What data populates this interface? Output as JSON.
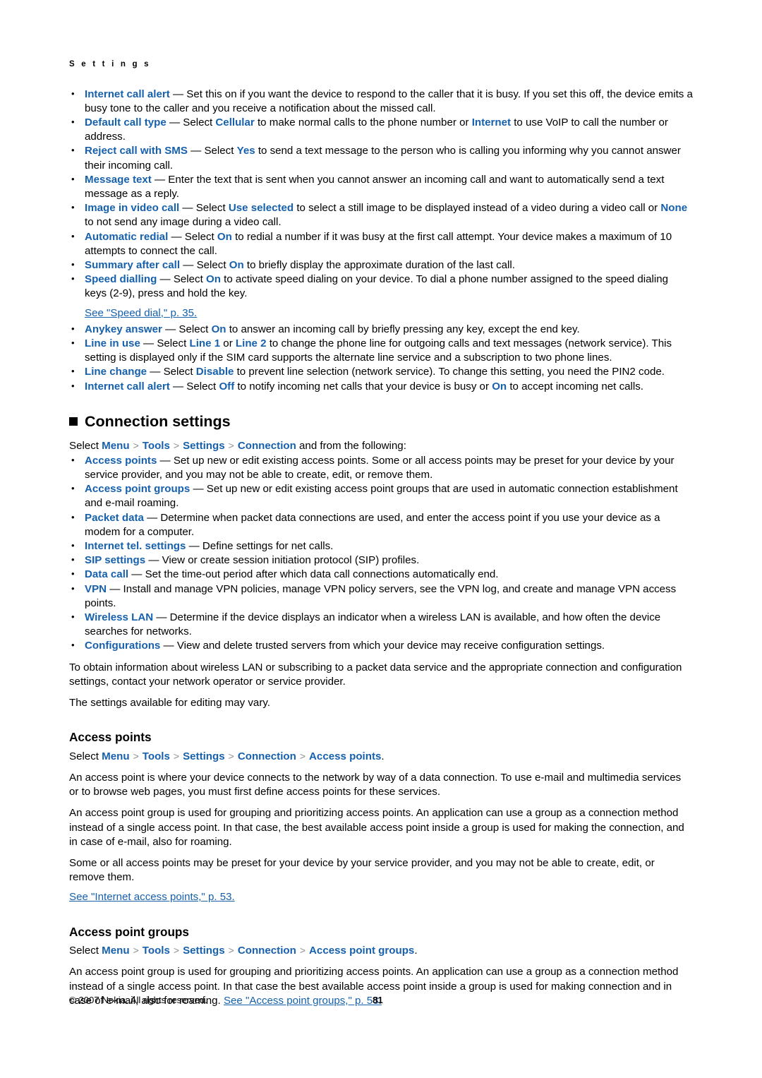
{
  "running_head": "S e t t i n g s",
  "colors": {
    "link_blue": "#1660ac",
    "text_black": "#000000",
    "separator_grey": "#8e8e8e",
    "page_background": "#ffffff"
  },
  "breadcrumb_separator": "chevron-right-icon",
  "call_settings_bullets": [
    {
      "term": "Internet call alert",
      "dash": " — ",
      "text": "Set this on if you want the device to respond to the caller that it is busy. If you set this off, the device emits a busy tone to the caller and you receive a notification about the missed call."
    },
    {
      "term": "Default call type",
      "dash": " — ",
      "pre": "Select ",
      "val1": "Cellular",
      "mid": " to make normal calls to the phone number or ",
      "val2": "Internet",
      "post": " to use VoIP to call the number or address."
    },
    {
      "term": "Reject call with SMS",
      "dash": " — ",
      "pre": "Select ",
      "val1": "Yes",
      "post": " to send a text message to the person who is calling you informing why you cannot answer their incoming call."
    },
    {
      "term": "Message text",
      "dash": " — ",
      "text": "Enter the text that is sent when you cannot answer an incoming call and want to automatically send a text message as a reply."
    },
    {
      "term": "Image in video call",
      "dash": " — ",
      "pre": "Select ",
      "val1": "Use selected",
      "mid": " to select a still image to be displayed instead of a video during a video call or ",
      "val2": "None",
      "post": " to not send any image during a video call."
    },
    {
      "term": "Automatic redial",
      "dash": " — ",
      "pre": "Select ",
      "val1": "On",
      "post": " to redial a number if it was busy at the first call attempt. Your device makes a maximum of 10 attempts to connect the call."
    },
    {
      "term": "Summary after call",
      "dash": " — ",
      "pre": "Select ",
      "val1": "On",
      "post": " to briefly display the approximate duration of the last call."
    },
    {
      "term": "Speed dialling",
      "dash": " — ",
      "pre": "Select ",
      "val1": "On",
      "post": " to activate speed dialing on your device. To dial a phone number assigned to the speed dialing keys (2-9), press and hold the key."
    }
  ],
  "speed_dial_xref": "See \"Speed dial,\" p. 35.",
  "call_settings_bullets_2": [
    {
      "term": "Anykey answer",
      "dash": " — ",
      "pre": "Select ",
      "val1": "On",
      "post": " to answer an incoming call by briefly pressing any key, except the end key."
    },
    {
      "term": "Line in use",
      "dash": " — ",
      "pre": "Select ",
      "val1": "Line 1",
      "mid": " or ",
      "val2": "Line 2",
      "post": " to change the phone line for outgoing calls and text messages (network service). This setting is displayed only if the SIM card supports the alternate line service and a subscription to two phone lines."
    },
    {
      "term": "Line change",
      "dash": " — ",
      "pre": "Select ",
      "val1": "Disable",
      "post": " to prevent line selection (network service). To change this setting, you need the PIN2 code."
    },
    {
      "term": "Internet call alert",
      "dash": " — ",
      "pre": "Select ",
      "val1": "Off",
      "mid": " to notify incoming net calls that your device is busy or ",
      "val2": "On",
      "post": " to accept incoming net calls."
    }
  ],
  "connection_settings": {
    "heading": "Connection settings",
    "crumb_prefix": "Select ",
    "crumbs": [
      "Menu",
      "Tools",
      "Settings",
      "Connection"
    ],
    "crumb_suffix": " and from the following:",
    "bullets": [
      {
        "term": "Access points",
        "dash": " — ",
        "text": "Set up new or edit existing access points. Some or all access points may be preset for your device by your service provider, and you may not be able to create, edit, or remove them."
      },
      {
        "term": "Access point groups",
        "dash": " — ",
        "text": "Set up new or edit existing access point groups that are used in automatic connection establishment and e-mail roaming."
      },
      {
        "term": "Packet data",
        "dash": " — ",
        "text": "Determine when packet data connections are used, and enter the access point if you use your device as a modem for a computer."
      },
      {
        "term": "Internet tel. settings",
        "dash": " — ",
        "text": "Define settings for net calls."
      },
      {
        "term": "SIP settings",
        "dash": " — ",
        "text": "View or create session initiation protocol (SIP) profiles."
      },
      {
        "term": "Data call",
        "dash": " — ",
        "text": "Set the time-out period after which data call connections automatically end."
      },
      {
        "term": "VPN",
        "dash": " — ",
        "text": "Install and manage VPN policies, manage VPN policy servers, see the VPN log, and create and manage VPN access points."
      },
      {
        "term": "Wireless LAN",
        "dash": " — ",
        "text": "Determine if the device displays an indicator when a wireless LAN is available, and how often the device searches for networks."
      },
      {
        "term": "Configurations",
        "dash": " — ",
        "text": "View and delete trusted servers from which your device may receive configuration settings."
      }
    ],
    "para1": "To obtain information about wireless LAN or subscribing to a packet data service and the appropriate connection and configuration settings, contact your network operator or service provider.",
    "para2": "The settings available for editing may vary."
  },
  "access_points": {
    "heading": "Access points",
    "crumb_prefix": "Select ",
    "crumbs": [
      "Menu",
      "Tools",
      "Settings",
      "Connection",
      "Access points"
    ],
    "crumb_suffix": ".",
    "para1": "An access point is where your device connects to the network by way of a data connection. To use e-mail and multimedia services or to browse web pages, you must first define access points for these services.",
    "para2": "An access point group is used for grouping and prioritizing access points. An application can use a group as a connection method instead of a single access point. In that case, the best available access point inside a group is used for making the connection, and in case of e-mail, also for roaming.",
    "para3": "Some or all access points may be preset for your device by your service provider, and you may not be able to create, edit, or remove them.",
    "xref": "See \"Internet access points,\" p. 53."
  },
  "access_point_groups": {
    "heading": "Access point groups",
    "crumb_prefix": "Select ",
    "crumbs": [
      "Menu",
      "Tools",
      "Settings",
      "Connection",
      "Access point groups"
    ],
    "crumb_suffix": ".",
    "para1": "An access point group is used for grouping and prioritizing access points. An application can use a group as a connection method instead of a single access point. In that case the best available access point inside a group is used for making connection and in case of e-mail, also for roaming. ",
    "xref": "See \"Access point groups,\" p. 53."
  },
  "footer": {
    "copyright": "© 2007 Nokia. All rights reserved.",
    "page_number": "81"
  }
}
